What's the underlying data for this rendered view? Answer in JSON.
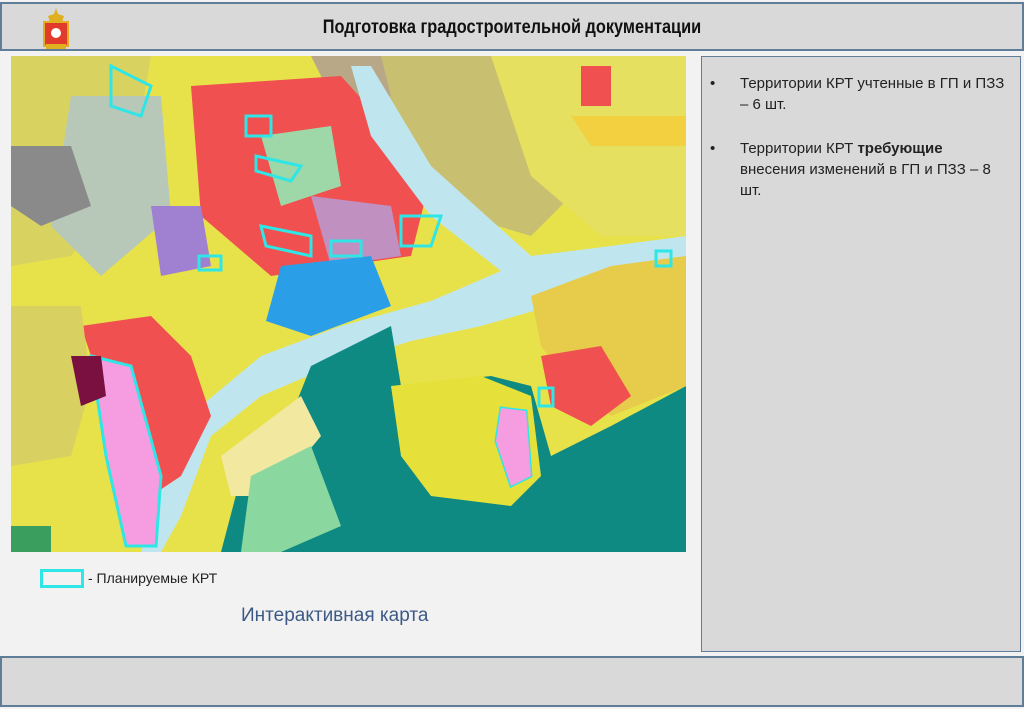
{
  "header": {
    "title": "Подготовка градостроительной документации",
    "emblem_icon": "moscow-region-coat-of-arms"
  },
  "panel": {
    "bullets": [
      {
        "text_before": "Территории КРТ учтенные в ГП и ПЗЗ – 6 шт.",
        "bold": "",
        "text_after": ""
      },
      {
        "text_before": "Территории КРТ ",
        "bold": "требующие",
        "text_after": " внесения изменений в ГП и ПЗЗ – 8 шт."
      }
    ],
    "bullet_char": "•"
  },
  "legend": {
    "label": "- Планируемые КРТ",
    "swatch_color": "#2ee6e6"
  },
  "map_link": "Интерактивная карта",
  "colors": {
    "frame": "#5f7c98",
    "box": "#d9d9d9",
    "river": "#bfe6ef",
    "teal": "#0f8a82",
    "red": "#f0504f",
    "yellow": "#f5ee3a",
    "pink": "#f59de0",
    "cyan": "#2ee6e6"
  }
}
